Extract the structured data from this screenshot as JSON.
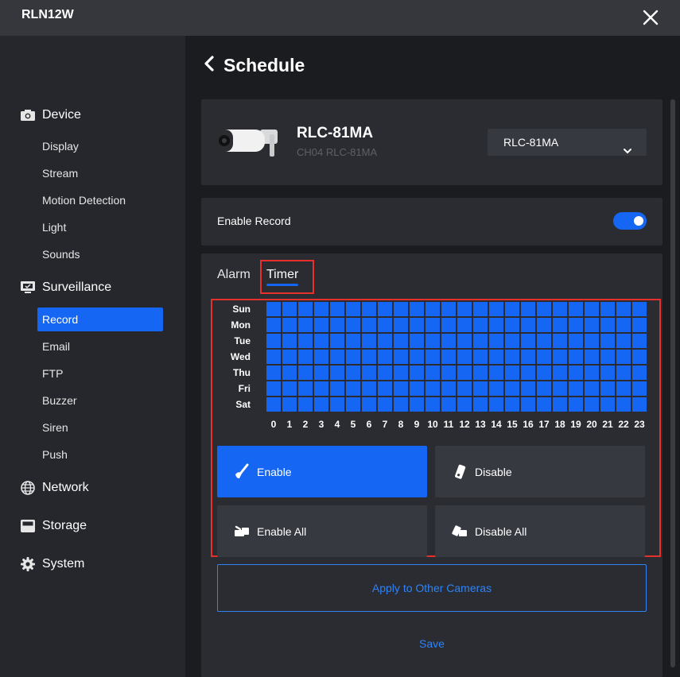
{
  "app": {
    "title": "RLN12W"
  },
  "sidebar": {
    "sections": [
      {
        "label": "Device",
        "icon": "camera-icon"
      },
      {
        "label": "Surveillance",
        "icon": "monitor-icon"
      },
      {
        "label": "Network",
        "icon": "globe-icon"
      },
      {
        "label": "Storage",
        "icon": "storage-icon"
      },
      {
        "label": "System",
        "icon": "gear-icon"
      }
    ],
    "device_items": [
      "Display",
      "Stream",
      "Motion Detection",
      "Light",
      "Sounds"
    ],
    "surveillance_items": [
      "Record",
      "Email",
      "FTP",
      "Buzzer",
      "Siren",
      "Push"
    ],
    "active_item": "Record"
  },
  "page": {
    "title": "Schedule"
  },
  "camera": {
    "name": "RLC-81MA",
    "subtitle": "CH04 RLC-81MA",
    "selected": "RLC-81MA"
  },
  "record": {
    "label": "Enable Record",
    "enabled": true
  },
  "tabs": [
    {
      "label": "Alarm",
      "active": false
    },
    {
      "label": "Timer",
      "active": true
    }
  ],
  "schedule": {
    "days": [
      "Sun",
      "Mon",
      "Tue",
      "Wed",
      "Thu",
      "Fri",
      "Sat"
    ],
    "hours": [
      "0",
      "1",
      "2",
      "3",
      "4",
      "5",
      "6",
      "7",
      "8",
      "9",
      "10",
      "11",
      "12",
      "13",
      "14",
      "15",
      "16",
      "17",
      "18",
      "19",
      "20",
      "21",
      "22",
      "23"
    ],
    "all_enabled": true,
    "cell_color": "#1566f2"
  },
  "actions": {
    "enable": "Enable",
    "disable": "Disable",
    "enable_all": "Enable All",
    "disable_all": "Disable All"
  },
  "buttons": {
    "apply": "Apply to Other Cameras",
    "save": "Save"
  },
  "colors": {
    "accent": "#1566f2",
    "highlight": "#e5302b",
    "link": "#2f83f5"
  }
}
